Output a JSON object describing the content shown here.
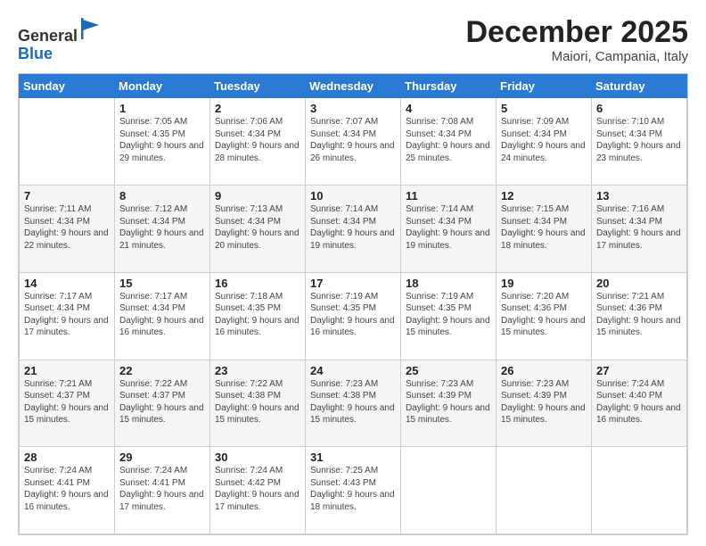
{
  "header": {
    "logo_line1": "General",
    "logo_line2": "Blue",
    "month_title": "December 2025",
    "location": "Maiori, Campania, Italy"
  },
  "weekdays": [
    "Sunday",
    "Monday",
    "Tuesday",
    "Wednesday",
    "Thursday",
    "Friday",
    "Saturday"
  ],
  "weeks": [
    [
      {
        "day": "",
        "sunrise": "",
        "sunset": "",
        "daylight": "",
        "empty": true
      },
      {
        "day": "1",
        "sunrise": "Sunrise: 7:05 AM",
        "sunset": "Sunset: 4:35 PM",
        "daylight": "Daylight: 9 hours and 29 minutes."
      },
      {
        "day": "2",
        "sunrise": "Sunrise: 7:06 AM",
        "sunset": "Sunset: 4:34 PM",
        "daylight": "Daylight: 9 hours and 28 minutes."
      },
      {
        "day": "3",
        "sunrise": "Sunrise: 7:07 AM",
        "sunset": "Sunset: 4:34 PM",
        "daylight": "Daylight: 9 hours and 26 minutes."
      },
      {
        "day": "4",
        "sunrise": "Sunrise: 7:08 AM",
        "sunset": "Sunset: 4:34 PM",
        "daylight": "Daylight: 9 hours and 25 minutes."
      },
      {
        "day": "5",
        "sunrise": "Sunrise: 7:09 AM",
        "sunset": "Sunset: 4:34 PM",
        "daylight": "Daylight: 9 hours and 24 minutes."
      },
      {
        "day": "6",
        "sunrise": "Sunrise: 7:10 AM",
        "sunset": "Sunset: 4:34 PM",
        "daylight": "Daylight: 9 hours and 23 minutes."
      }
    ],
    [
      {
        "day": "7",
        "sunrise": "Sunrise: 7:11 AM",
        "sunset": "Sunset: 4:34 PM",
        "daylight": "Daylight: 9 hours and 22 minutes."
      },
      {
        "day": "8",
        "sunrise": "Sunrise: 7:12 AM",
        "sunset": "Sunset: 4:34 PM",
        "daylight": "Daylight: 9 hours and 21 minutes."
      },
      {
        "day": "9",
        "sunrise": "Sunrise: 7:13 AM",
        "sunset": "Sunset: 4:34 PM",
        "daylight": "Daylight: 9 hours and 20 minutes."
      },
      {
        "day": "10",
        "sunrise": "Sunrise: 7:14 AM",
        "sunset": "Sunset: 4:34 PM",
        "daylight": "Daylight: 9 hours and 19 minutes."
      },
      {
        "day": "11",
        "sunrise": "Sunrise: 7:14 AM",
        "sunset": "Sunset: 4:34 PM",
        "daylight": "Daylight: 9 hours and 19 minutes."
      },
      {
        "day": "12",
        "sunrise": "Sunrise: 7:15 AM",
        "sunset": "Sunset: 4:34 PM",
        "daylight": "Daylight: 9 hours and 18 minutes."
      },
      {
        "day": "13",
        "sunrise": "Sunrise: 7:16 AM",
        "sunset": "Sunset: 4:34 PM",
        "daylight": "Daylight: 9 hours and 17 minutes."
      }
    ],
    [
      {
        "day": "14",
        "sunrise": "Sunrise: 7:17 AM",
        "sunset": "Sunset: 4:34 PM",
        "daylight": "Daylight: 9 hours and 17 minutes."
      },
      {
        "day": "15",
        "sunrise": "Sunrise: 7:17 AM",
        "sunset": "Sunset: 4:34 PM",
        "daylight": "Daylight: 9 hours and 16 minutes."
      },
      {
        "day": "16",
        "sunrise": "Sunrise: 7:18 AM",
        "sunset": "Sunset: 4:35 PM",
        "daylight": "Daylight: 9 hours and 16 minutes."
      },
      {
        "day": "17",
        "sunrise": "Sunrise: 7:19 AM",
        "sunset": "Sunset: 4:35 PM",
        "daylight": "Daylight: 9 hours and 16 minutes."
      },
      {
        "day": "18",
        "sunrise": "Sunrise: 7:19 AM",
        "sunset": "Sunset: 4:35 PM",
        "daylight": "Daylight: 9 hours and 15 minutes."
      },
      {
        "day": "19",
        "sunrise": "Sunrise: 7:20 AM",
        "sunset": "Sunset: 4:36 PM",
        "daylight": "Daylight: 9 hours and 15 minutes."
      },
      {
        "day": "20",
        "sunrise": "Sunrise: 7:21 AM",
        "sunset": "Sunset: 4:36 PM",
        "daylight": "Daylight: 9 hours and 15 minutes."
      }
    ],
    [
      {
        "day": "21",
        "sunrise": "Sunrise: 7:21 AM",
        "sunset": "Sunset: 4:37 PM",
        "daylight": "Daylight: 9 hours and 15 minutes."
      },
      {
        "day": "22",
        "sunrise": "Sunrise: 7:22 AM",
        "sunset": "Sunset: 4:37 PM",
        "daylight": "Daylight: 9 hours and 15 minutes."
      },
      {
        "day": "23",
        "sunrise": "Sunrise: 7:22 AM",
        "sunset": "Sunset: 4:38 PM",
        "daylight": "Daylight: 9 hours and 15 minutes."
      },
      {
        "day": "24",
        "sunrise": "Sunrise: 7:23 AM",
        "sunset": "Sunset: 4:38 PM",
        "daylight": "Daylight: 9 hours and 15 minutes."
      },
      {
        "day": "25",
        "sunrise": "Sunrise: 7:23 AM",
        "sunset": "Sunset: 4:39 PM",
        "daylight": "Daylight: 9 hours and 15 minutes."
      },
      {
        "day": "26",
        "sunrise": "Sunrise: 7:23 AM",
        "sunset": "Sunset: 4:39 PM",
        "daylight": "Daylight: 9 hours and 15 minutes."
      },
      {
        "day": "27",
        "sunrise": "Sunrise: 7:24 AM",
        "sunset": "Sunset: 4:40 PM",
        "daylight": "Daylight: 9 hours and 16 minutes."
      }
    ],
    [
      {
        "day": "28",
        "sunrise": "Sunrise: 7:24 AM",
        "sunset": "Sunset: 4:41 PM",
        "daylight": "Daylight: 9 hours and 16 minutes."
      },
      {
        "day": "29",
        "sunrise": "Sunrise: 7:24 AM",
        "sunset": "Sunset: 4:41 PM",
        "daylight": "Daylight: 9 hours and 17 minutes."
      },
      {
        "day": "30",
        "sunrise": "Sunrise: 7:24 AM",
        "sunset": "Sunset: 4:42 PM",
        "daylight": "Daylight: 9 hours and 17 minutes."
      },
      {
        "day": "31",
        "sunrise": "Sunrise: 7:25 AM",
        "sunset": "Sunset: 4:43 PM",
        "daylight": "Daylight: 9 hours and 18 minutes."
      },
      {
        "day": "",
        "sunrise": "",
        "sunset": "",
        "daylight": "",
        "empty": true
      },
      {
        "day": "",
        "sunrise": "",
        "sunset": "",
        "daylight": "",
        "empty": true
      },
      {
        "day": "",
        "sunrise": "",
        "sunset": "",
        "daylight": "",
        "empty": true
      }
    ]
  ]
}
